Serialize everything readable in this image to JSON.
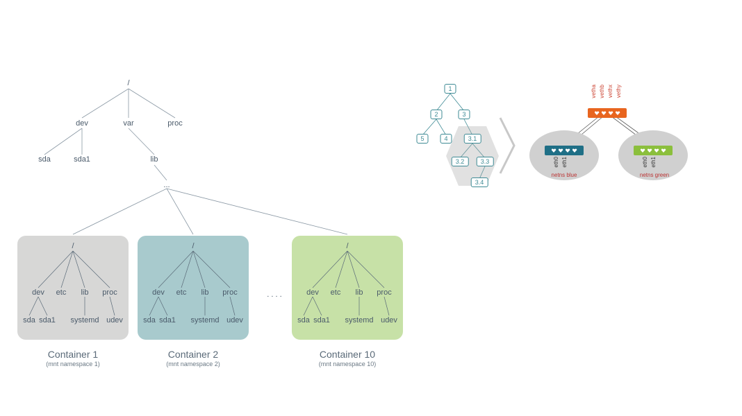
{
  "filesystem_tree": {
    "root": "/",
    "level1": {
      "dev": "dev",
      "var": "var",
      "proc": "proc"
    },
    "level2_dev": {
      "sda": "sda",
      "sda1": "sda1"
    },
    "level2_var": {
      "lib": "lib"
    },
    "ellipsis": "..."
  },
  "containers": [
    {
      "title": "Container 1",
      "subtitle": "(mnt namespace 1)",
      "root": "/",
      "dirs": [
        "dev",
        "etc",
        "lib",
        "proc"
      ],
      "leaves_dev": [
        "sda",
        "sda1"
      ],
      "leaf_lib": "systemd",
      "leaf_proc": "udev"
    },
    {
      "title": "Container 2",
      "subtitle": "(mnt namespace 2)",
      "root": "/",
      "dirs": [
        "dev",
        "etc",
        "lib",
        "proc"
      ],
      "leaves_dev": [
        "sda",
        "sda1"
      ],
      "leaf_lib": "systemd",
      "leaf_proc": "udev"
    },
    {
      "title": "Container 10",
      "subtitle": "(mnt namespace 10)",
      "root": "/",
      "dirs": [
        "dev",
        "etc",
        "lib",
        "proc"
      ],
      "leaves_dev": [
        "sda",
        "sda1"
      ],
      "leaf_lib": "systemd",
      "leaf_proc": "udev"
    }
  ],
  "container_gap": ". . . .",
  "pid_tree": {
    "nodes": [
      "1",
      "2",
      "3",
      "5",
      "4",
      "3.1",
      "3.2",
      "3.3",
      "3.4"
    ]
  },
  "net": {
    "top_labels": [
      "vetha",
      "vethb",
      "vethx",
      "vethy"
    ],
    "blue_labels": [
      "eth0",
      "eth1"
    ],
    "green_labels": [
      "eth0",
      "eth1"
    ],
    "ns_blue": "netns blue",
    "ns_green": "netns green"
  }
}
